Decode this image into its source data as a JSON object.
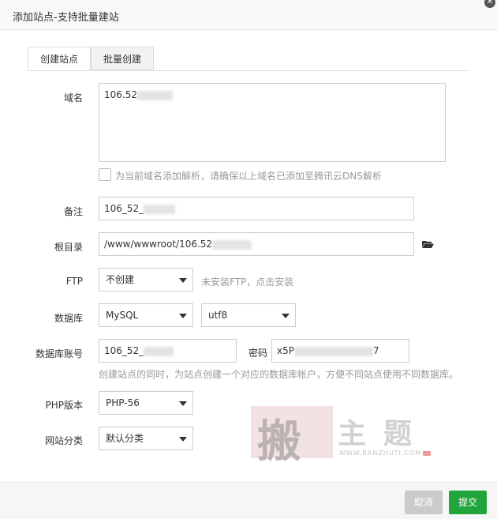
{
  "dialog": {
    "title": "添加站点-支持批量建站"
  },
  "tabs": [
    {
      "label": "创建站点"
    },
    {
      "label": "批量创建"
    }
  ],
  "form": {
    "domain_label": "域名",
    "domain_value": "106.52",
    "dns_checkbox_label": "为当前域名添加解析，请确保以上域名已添加至腾讯云DNS解析",
    "remark_label": "备注",
    "remark_value": "106_52_",
    "root_label": "根目录",
    "root_value": "/www/wwwroot/106.52",
    "ftp_label": "FTP",
    "ftp_value": "不创建",
    "ftp_hint": "未安装FTP，点击安装",
    "db_label": "数据库",
    "db_type": "MySQL",
    "db_charset": "utf8",
    "db_account_label": "数据库账号",
    "db_account_value": "106_52_",
    "password_label": "密码",
    "password_value_prefix": "x5P",
    "password_value_suffix": "7",
    "db_hint": "创建站点的同时，为站点创建一个对应的数据库帐户，方便不同站点使用不同数据库。",
    "php_label": "PHP版本",
    "php_value": "PHP-56",
    "category_label": "网站分类",
    "category_value": "默认分类"
  },
  "footer": {
    "cancel_label": "取消",
    "submit_label": "提交"
  },
  "watermark": {
    "char1": "搬",
    "char2": "主",
    "char3": "题",
    "url": "WWW.BANZHUTI.COM"
  },
  "colors": {
    "accent": "#20a53a",
    "cancel": "#cbcbcb"
  },
  "icons": {
    "folder": "folder-open-icon",
    "close": "close-icon"
  }
}
